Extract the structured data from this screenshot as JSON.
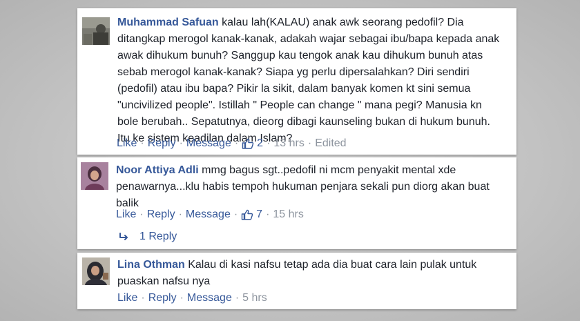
{
  "comments": [
    {
      "author": "Muhammad Safuan",
      "text": "kalau lah(KALAU) anak awk seorang pedofil? Dia ditangkap merogol kanak-kanak, adakah wajar sebagai ibu/bapa kepada anak awak dihukum bunuh? Sanggup kau tengok anak kau dihukum bunuh atas sebab merogol kanak-kanak? Siapa yg perlu dipersalahkan? Diri sendiri (pedofil) atau ibu bapa? Pikir la sikit, dalam banyak komen kt sini semua \"uncivilized people\". Istillah \" People can change \" mana pegi? Manusia kn bole berubah.. Sepatutnya, dieorg dibagi kaunseling bukan di hukum bunuh. Itu ke sistem keadilan dalam Islam?",
      "like": "Like",
      "reply": "Reply",
      "message": "Message",
      "likes": "2",
      "time": "13 hrs",
      "edited": "Edited"
    },
    {
      "author": "Noor Attiya Adli",
      "text": "mmg bagus sgt..pedofil ni mcm penyakit mental xde penawarnya...klu habis tempoh hukuman penjara sekali pun diorg akan buat balik",
      "like": "Like",
      "reply": "Reply",
      "message": "Message",
      "likes": "7",
      "time": "15 hrs",
      "replies_label": "1 Reply"
    },
    {
      "author": "Lina Othman",
      "text": "Kalau di kasi nafsu tetap ada dia buat cara lain pulak untuk puaskan nafsu nya",
      "like": "Like",
      "reply": "Reply",
      "message": "Message",
      "time": "5 hrs"
    }
  ],
  "separator": "·",
  "colors": {
    "link": "#365899",
    "meta": "#8d949e",
    "text": "#1d2129"
  },
  "icons": {
    "like": "thumbs-up-icon",
    "reply_arrow": "reply-arrow-icon"
  }
}
